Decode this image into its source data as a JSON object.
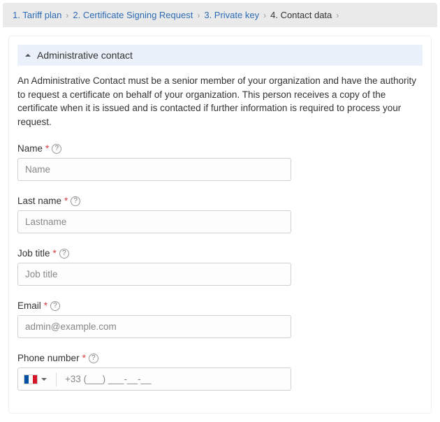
{
  "breadcrumb": {
    "steps": [
      {
        "label": "1. Tariff plan",
        "active": false
      },
      {
        "label": "2. Certificate Signing Request",
        "active": false
      },
      {
        "label": "3. Private key",
        "active": false
      },
      {
        "label": "4. Contact data",
        "active": true
      }
    ]
  },
  "section": {
    "title": "Administrative contact",
    "description": "An Administrative Contact must be a senior member of your organization and have the authority to request a certificate on behalf of your organization. This person receives a copy of the certificate when it is issued and is contacted if further information is required to process your request."
  },
  "form": {
    "name": {
      "label": "Name ",
      "required": "*",
      "placeholder": "Name",
      "value": ""
    },
    "lastname": {
      "label": "Last name",
      "required": "*",
      "placeholder": "Lastname",
      "value": ""
    },
    "jobtitle": {
      "label": "Job title",
      "required": "*",
      "placeholder": "Job title",
      "value": ""
    },
    "email": {
      "label": "Email",
      "required": "*",
      "placeholder": "admin@example.com",
      "value": ""
    },
    "phone": {
      "label": "Phone number",
      "required": "*",
      "placeholder": "+33 (___) ___-__-__",
      "country": "FR",
      "value": ""
    }
  },
  "icons": {
    "help": "?"
  }
}
